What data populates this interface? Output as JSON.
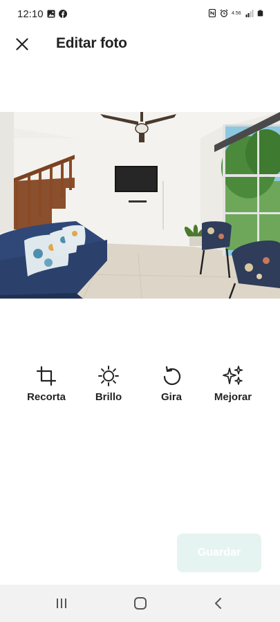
{
  "status_bar": {
    "time": "12:10",
    "left_icons": [
      "gallery-icon",
      "facebook-icon"
    ],
    "right_icons": [
      "nfc-icon",
      "alarm-icon",
      "network-speed-icon",
      "signal-icon",
      "battery-icon"
    ],
    "network_speed": "4.56"
  },
  "header": {
    "title": "Editar foto",
    "close_icon": "close-icon"
  },
  "photo": {
    "description_icon": "living-room-photo"
  },
  "tools": [
    {
      "label": "Recorta",
      "icon": "crop-icon"
    },
    {
      "label": "Brillo",
      "icon": "brightness-icon"
    },
    {
      "label": "Gira",
      "icon": "rotate-icon"
    },
    {
      "label": "Mejorar",
      "icon": "sparkle-icon"
    }
  ],
  "footer": {
    "save_label": "Guardar",
    "save_color": "#e6f4f1"
  },
  "nav_bar": {
    "buttons": [
      "recent-apps-icon",
      "home-icon",
      "back-icon"
    ]
  }
}
